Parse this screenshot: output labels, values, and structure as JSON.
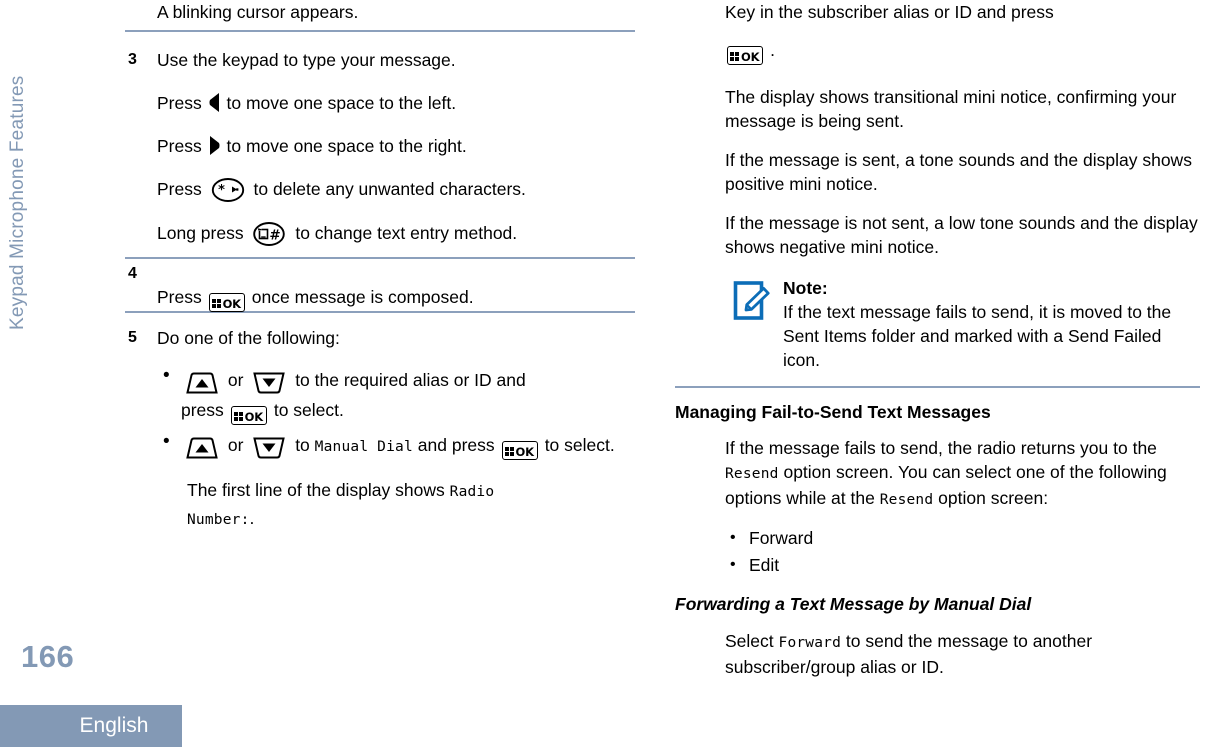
{
  "document": {
    "chapter_tab": "Keypad Microphone Features",
    "page_number": "166",
    "language_footer": "English"
  },
  "colors": {
    "accent_blue": "#0C6DB7",
    "chapter_tab": "#8399B5",
    "rule": "#8CA0BC",
    "footer_bar": "#8399B5"
  },
  "left_column": {
    "intro_line": "A blinking cursor appears.",
    "step3": {
      "number": "3",
      "title": "Use the keypad to type your message.",
      "lines": [
        {
          "pre": "Press",
          "icon": "nav-left-arrow-icon",
          "post": "to move one space to the left."
        },
        {
          "pre": "Press",
          "icon": "nav-right-arrow-icon",
          "post": "to move one space to the right."
        },
        {
          "pre": "Press",
          "icon": "star-delete-key-icon",
          "post": "to delete any unwanted characters."
        },
        {
          "pre": "Long press",
          "icon": "hash-text-entry-key-icon",
          "post": "to change text entry method."
        }
      ]
    },
    "step4": {
      "number": "4",
      "pre": "Press",
      "icon": "menu-ok-key-icon",
      "post": "once message is composed."
    },
    "step5": {
      "number": "5",
      "title": "Do one of the following:",
      "bullets": [
        {
          "icon_up": "scroll-up-key-icon",
          "or_label": "or",
          "icon_down": "scroll-down-key-icon",
          "mid": "to the required alias or ID and",
          "press_label": "press",
          "icon_ok": "menu-ok-key-icon",
          "tail": "to select."
        },
        {
          "icon_up": "scroll-up-key-icon",
          "or_label": "or",
          "icon_down": "scroll-down-key-icon",
          "mid_pre": "to",
          "mid_mono": "Manual Dial",
          "mid_post": "and press",
          "icon_ok": "menu-ok-key-icon",
          "tail": "to select."
        }
      ],
      "result_pre": "The first line of the display shows",
      "result_mono_1": "Radio",
      "result_mono_2": "Number:",
      "result_post": "."
    }
  },
  "right_column": {
    "key_in_line": {
      "text": "Key in the subscriber alias or ID and press",
      "icon": "menu-ok-key-icon",
      "period": "."
    },
    "paragraphs": [
      "The display shows transitional mini notice, confirming your message is being sent.",
      "If the message is sent, a tone sounds and the display shows positive mini notice.",
      "If the message is not sent, a low tone sounds and the display shows negative mini notice."
    ],
    "note": {
      "icon": "note-pencil-icon",
      "title": "Note:",
      "text": "If the text message fails to send, it is moved to the Sent Items folder and marked with a Send Failed icon."
    },
    "section_heading": "Managing Fail-to-Send Text Messages",
    "section_body": {
      "part1": "If the message fails to send, the radio returns you to the",
      "mono1": "Resend",
      "part2": "option screen. You can select one of the following options while at the",
      "mono2": "Resend",
      "part3": "option screen:"
    },
    "options": [
      "Forward",
      "Edit"
    ],
    "subheading": "Forwarding a Text Message by Manual Dial",
    "sub_body": {
      "part1": "Select",
      "mono": "Forward",
      "part2": "to send the message to another subscriber/group alias or ID."
    }
  }
}
